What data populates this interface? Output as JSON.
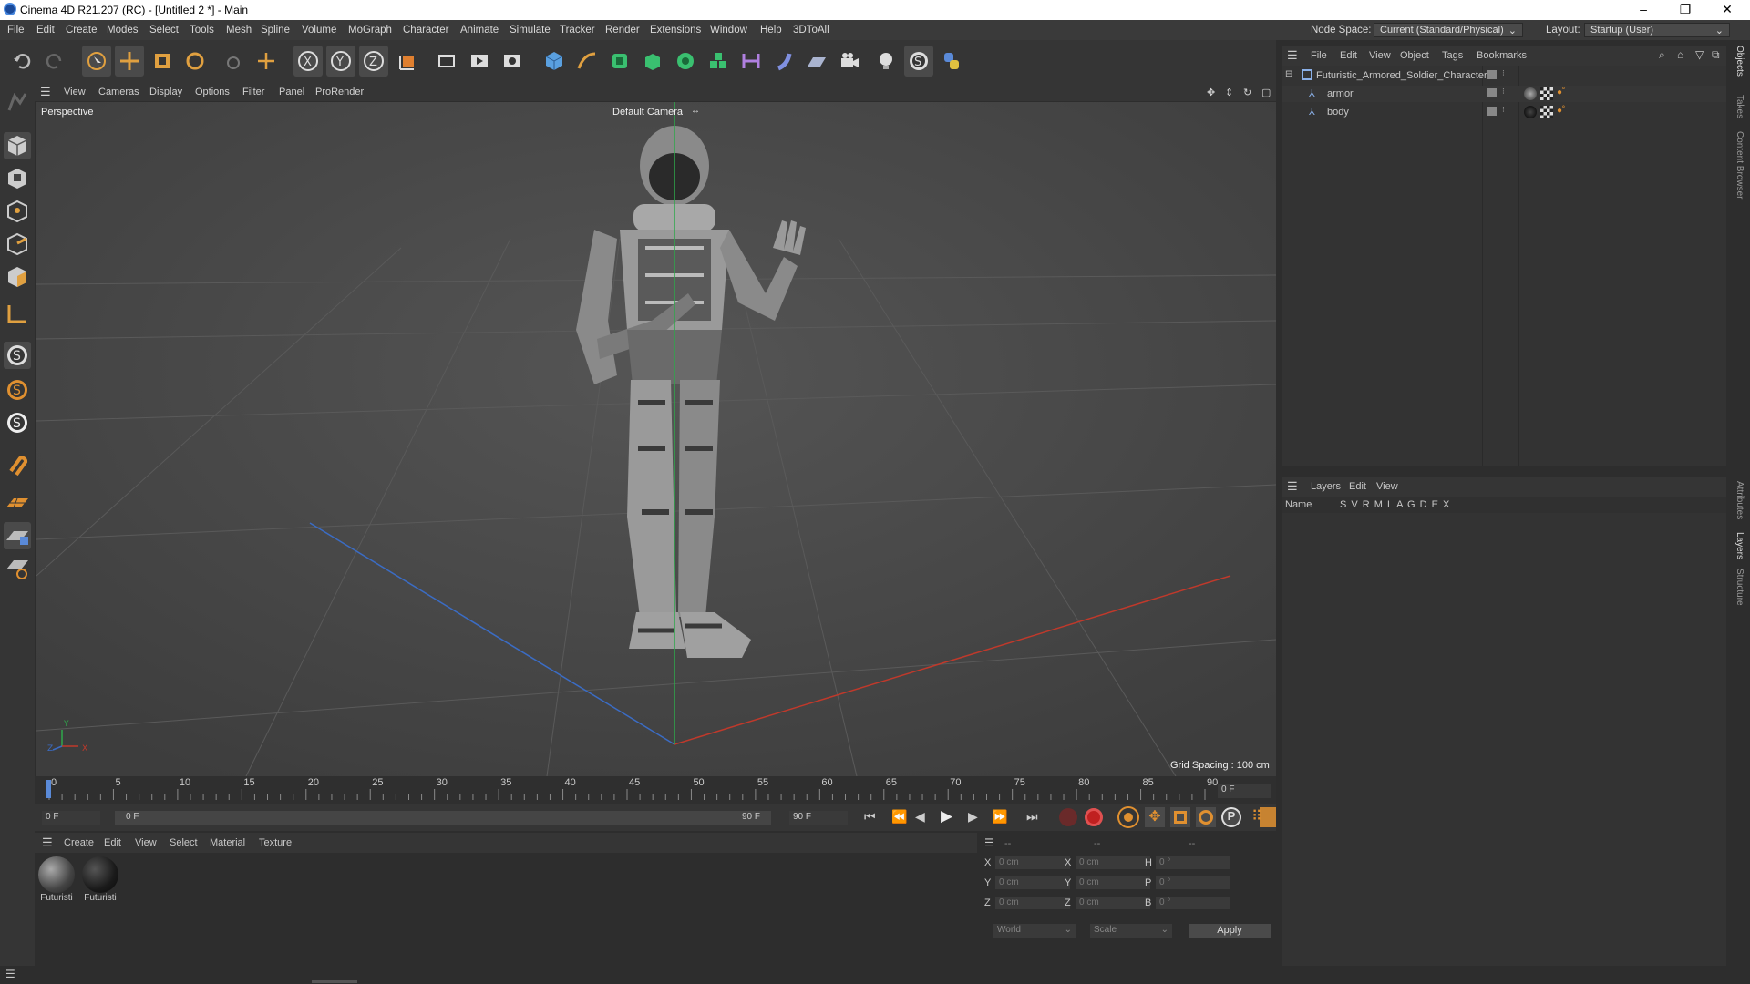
{
  "window": {
    "title": "Cinema 4D R21.207 (RC) - [Untitled 2 *] - Main"
  },
  "menu": [
    "File",
    "Edit",
    "Create",
    "Modes",
    "Select",
    "Tools",
    "Mesh",
    "Spline",
    "Volume",
    "MoGraph",
    "Character",
    "Animate",
    "Simulate",
    "Tracker",
    "Render",
    "Extensions",
    "Window",
    "Help",
    "3DToAll"
  ],
  "node_space": {
    "label": "Node Space:",
    "value": "Current (Standard/Physical)"
  },
  "layout": {
    "label": "Layout:",
    "value": "Startup (User)"
  },
  "viewport_menu": [
    "View",
    "Cameras",
    "Display",
    "Options",
    "Filter",
    "Panel",
    "ProRender"
  ],
  "viewport": {
    "label": "Perspective",
    "camera": "Default Camera",
    "grid_spacing": "Grid Spacing : 100 cm"
  },
  "timeline": {
    "ticks": [
      "0",
      "5",
      "10",
      "15",
      "20",
      "25",
      "30",
      "35",
      "40",
      "45",
      "50",
      "55",
      "60",
      "65",
      "70",
      "75",
      "80",
      "85",
      "90"
    ],
    "current_frame": "0 F"
  },
  "playback": {
    "start": "0 F",
    "range_start": "0 F",
    "range_end": "90 F",
    "end": "90 F"
  },
  "material_menu": [
    "Create",
    "Edit",
    "View",
    "Select",
    "Material",
    "Texture"
  ],
  "materials": [
    "Futuristi",
    "Futuristi"
  ],
  "coords": {
    "headers": [
      "--",
      "--",
      "--"
    ],
    "rows": [
      {
        "a": "X",
        "av": "0 cm",
        "b": "X",
        "bv": "0 cm",
        "c": "H",
        "cv": "0 °"
      },
      {
        "a": "Y",
        "av": "0 cm",
        "b": "Y",
        "bv": "0 cm",
        "c": "P",
        "cv": "0 °"
      },
      {
        "a": "Z",
        "av": "0 cm",
        "b": "Z",
        "bv": "0 cm",
        "c": "B",
        "cv": "0 °"
      }
    ],
    "space": "World",
    "mode": "Scale",
    "apply": "Apply"
  },
  "object_menu": [
    "File",
    "Edit",
    "View",
    "Object",
    "Tags",
    "Bookmarks"
  ],
  "objects": [
    {
      "name": "Futuristic_Armored_Soldier_Character"
    },
    {
      "name": "armor"
    },
    {
      "name": "body"
    }
  ],
  "layers_menu": [
    "Layers",
    "Edit",
    "View"
  ],
  "layers_header": {
    "name": "Name",
    "cols": "S V R M L A G D E X"
  },
  "side_tabs": [
    "Objects",
    "Takes",
    "Content Browser",
    "Attributes",
    "Layers",
    "Structure"
  ],
  "colors": {
    "accent": "#5a8ad8",
    "x_axis": "#c0392b",
    "z_axis": "#3b6cc4",
    "y_axis": "#2ea84b"
  }
}
